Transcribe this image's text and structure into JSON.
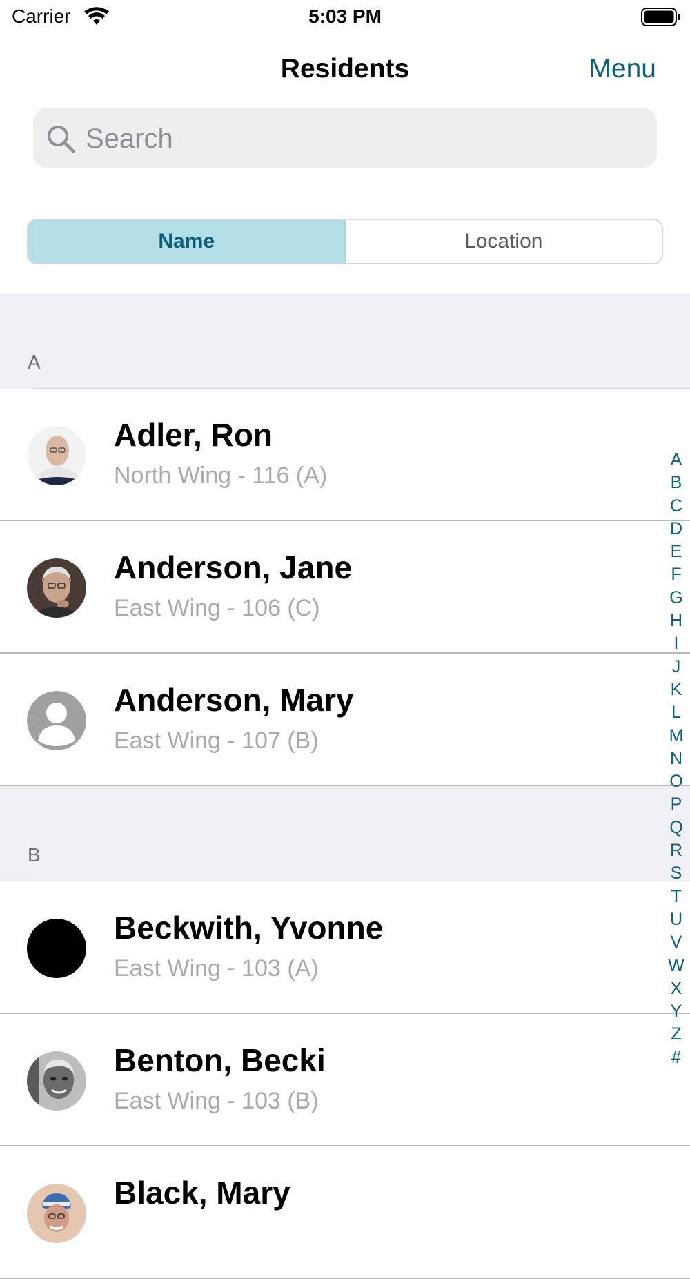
{
  "status_bar": {
    "carrier": "Carrier",
    "time": "5:03 PM"
  },
  "nav": {
    "title": "Residents",
    "menu_label": "Menu"
  },
  "search": {
    "placeholder": "Search",
    "value": ""
  },
  "segments": {
    "name": "Name",
    "location": "Location",
    "selected": "Name"
  },
  "sections": [
    {
      "letter": "A",
      "rows": [
        {
          "name": "Adler, Ron",
          "location": "North Wing - 116 (A)",
          "avatar": "photo"
        },
        {
          "name": "Anderson, Jane",
          "location": "East Wing - 106 (C)",
          "avatar": "photo"
        },
        {
          "name": "Anderson, Mary",
          "location": "East Wing - 107 (B)",
          "avatar": "placeholder-person-icon"
        }
      ]
    },
    {
      "letter": "B",
      "rows": [
        {
          "name": "Beckwith, Yvonne",
          "location": "East Wing - 103 (A)",
          "avatar": "black-circle"
        },
        {
          "name": "Benton, Becki",
          "location": "East Wing - 103 (B)",
          "avatar": "photo"
        },
        {
          "name": "Black, Mary",
          "location": "",
          "avatar": "photo"
        }
      ]
    }
  ],
  "index_letters": [
    "A",
    "B",
    "C",
    "D",
    "E",
    "F",
    "G",
    "H",
    "I",
    "J",
    "K",
    "L",
    "M",
    "N",
    "O",
    "P",
    "Q",
    "R",
    "S",
    "T",
    "U",
    "V",
    "W",
    "X",
    "Y",
    "Z",
    "#"
  ],
  "colors": {
    "accent": "#0f5f78",
    "segment_selected_bg": "#b2e0e6",
    "section_bg": "#efeff4",
    "secondary_text": "#a9a9ad"
  }
}
